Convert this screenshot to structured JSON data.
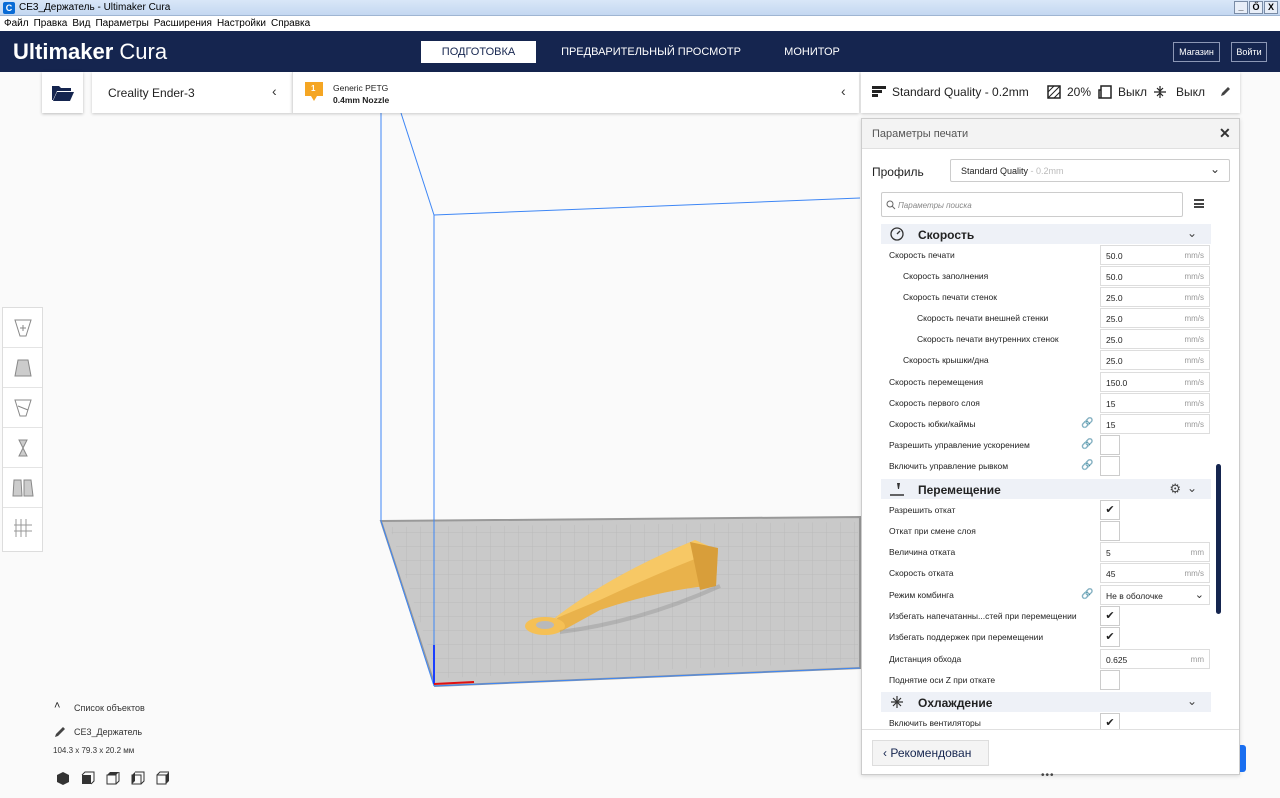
{
  "window": {
    "title": "CE3_Держатель - Ultimaker Cura",
    "app_icon": "C"
  },
  "window_buttons": [
    "_",
    "Ő",
    "X"
  ],
  "menu": [
    "Файл",
    "Правка",
    "Вид",
    "Параметры",
    "Расширения",
    "Настройки",
    "Справка"
  ],
  "header": {
    "logo_bold": "Ultimaker",
    "logo_light": " Cura",
    "stages": {
      "prepare": "ПОДГОТОВКА",
      "preview": "ПРЕДВАРИТЕЛЬНЫЙ ПРОСМОТР",
      "monitor": "МОНИТОР"
    },
    "marketplace": "Магазин",
    "signin": "Войти",
    "active_stage": "ПОДГОТОВКА"
  },
  "machine": {
    "name": "Creality Ender-3"
  },
  "material": {
    "extruder_number": "1",
    "name": "Generic PETG",
    "nozzle": "0.4mm Nozzle"
  },
  "print_setup": {
    "quality": "Standard Quality - 0.2mm",
    "infill": "20%",
    "support": "Выкл",
    "adhesion": "Выкл"
  },
  "panel": {
    "title": "Параметры печати",
    "profile_label": "Профиль",
    "profile_value": "Standard Quality",
    "profile_suffix": " - 0.2mm",
    "search_placeholder": "Параметры поиска",
    "footer_button": "Рекомендован"
  },
  "categories": {
    "speed": "Скорость",
    "travel": "Перемещение",
    "cooling": "Охлаждение"
  },
  "speed_rows": [
    {
      "label": "Скорость печати",
      "value": "50.0",
      "unit": "mm/s"
    },
    {
      "label": "Скорость заполнения",
      "value": "50.0",
      "unit": "mm/s"
    },
    {
      "label": "Скорость печати стенок",
      "value": "25.0",
      "unit": "mm/s"
    },
    {
      "label": "Скорость печати внешней стенки",
      "value": "25.0",
      "unit": "mm/s"
    },
    {
      "label": "Скорость печати внутренних стенок",
      "value": "25.0",
      "unit": "mm/s"
    },
    {
      "label": "Скорость крышки/дна",
      "value": "25.0",
      "unit": "mm/s"
    },
    {
      "label": "Скорость перемещения",
      "value": "150.0",
      "unit": "mm/s"
    },
    {
      "label": "Скорость первого слоя",
      "value": "15",
      "unit": "mm/s"
    },
    {
      "label": "Скорость юбки/каймы",
      "value": "15",
      "unit": "mm/s"
    },
    {
      "label": "Разрешить управление ускорением"
    },
    {
      "label": "Включить управление рывком"
    }
  ],
  "travel_rows": [
    {
      "label": "Разрешить откат",
      "checked": "✔"
    },
    {
      "label": "Откат при смене слоя",
      "checked": ""
    },
    {
      "label": "Величина отката",
      "value": "5",
      "unit": "mm"
    },
    {
      "label": "Скорость отката",
      "value": "45",
      "unit": "mm/s"
    },
    {
      "label": "Режим комбинга",
      "value": "Не в оболочке"
    },
    {
      "label": "Избегать напечатанны...стей при перемещении",
      "checked": "✔"
    },
    {
      "label": "Избегать поддержек при перемещении",
      "checked": "✔"
    },
    {
      "label": "Дистанция обхода",
      "value": "0.625",
      "unit": "mm"
    },
    {
      "label": "Поднятие оси Z при откате",
      "checked": ""
    }
  ],
  "cooling_rows": [
    {
      "label": "Включить вентиляторы",
      "checked": "✔"
    }
  ],
  "objects": {
    "header": "Список объектов",
    "name": "CE3_Держатель",
    "dimensions": "104.3 x 79.3 x 20.2 мм"
  },
  "colors": {
    "header": "#15254f",
    "accent": "#196ef0",
    "model": "#f5c055",
    "build_volume_lines": "#3d86f5"
  }
}
